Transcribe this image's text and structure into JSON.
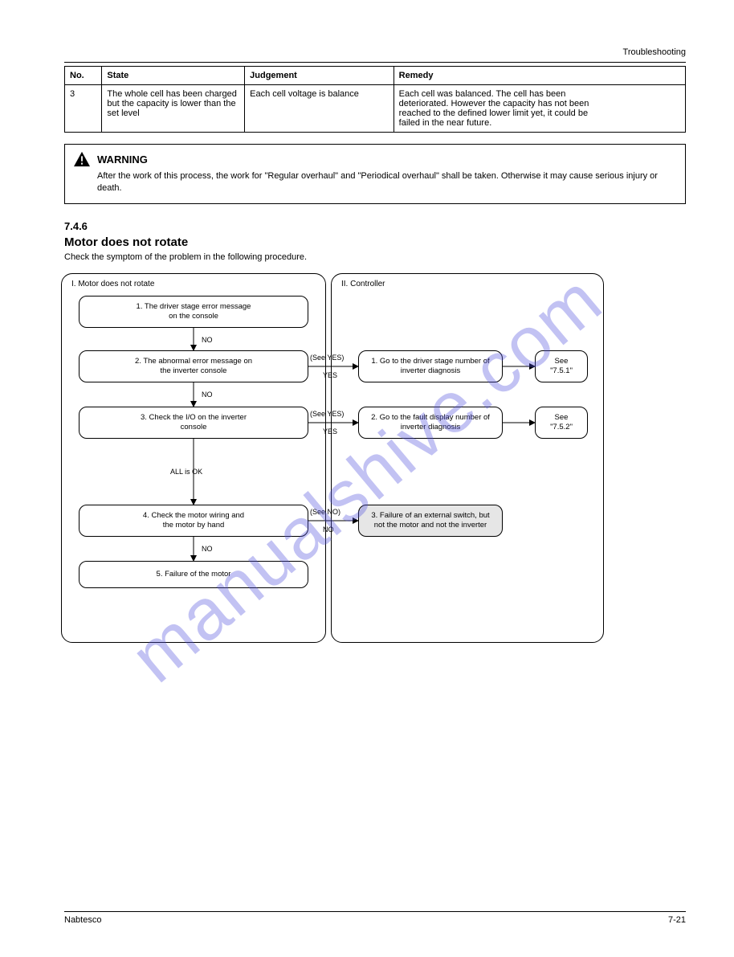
{
  "header": {
    "title": "Troubleshooting"
  },
  "table": {
    "cols": [
      "No.",
      "State",
      "Judgement",
      "Remedy"
    ],
    "row": {
      "no": "3",
      "state_lines": [
        "The whole cell has been charged",
        "but the capacity is lower than the",
        "set level"
      ],
      "judgement_lines": [
        "Each cell voltage is balance"
      ],
      "remedy_lines": [
        "Each cell was balanced. The cell has been",
        "deteriorated. However the capacity has not been",
        "reached to the defined lower limit yet, it could be",
        "failed in the near future."
      ]
    }
  },
  "warning": {
    "label": "WARNING",
    "text": "After the work of this process, the work for \"Regular overhaul\" and \"Periodical overhaul\" shall be taken. Otherwise it may cause serious injury or death."
  },
  "section": {
    "num": "7.4.6",
    "title": "Motor does not rotate",
    "sub": "Check the symptom of the problem in the following procedure."
  },
  "flow": {
    "panel_i": "I. Motor does not rotate",
    "panel_ii": "II. Controller",
    "n1": [
      "1. The driver stage error message",
      "on the console"
    ],
    "n2": [
      "2. The abnormal error message on",
      "the inverter console"
    ],
    "n3": [
      "3. Check the I/O on the inverter",
      "console"
    ],
    "n4": [
      "4. Check the motor wiring and",
      "the motor by hand"
    ],
    "n5": [
      "5. Failure of the motor"
    ],
    "r1": [
      "1. Go to the driver stage number of",
      "inverter diagnosis"
    ],
    "r1r": [
      "See",
      "\"7.5.1\""
    ],
    "r2": [
      "2. Go to the fault display number of",
      "inverter diagnosis"
    ],
    "r2r": [
      "See",
      "\"7.5.2\""
    ],
    "r3": [
      "3. Failure of an external switch, but",
      "not the motor and not the inverter"
    ],
    "yes": "YES",
    "no": "NO",
    "see_yes": "(See YES)",
    "see_no": "(See NO)",
    "all_ok": "ALL is OK"
  },
  "footer": {
    "left": "Nabtesco",
    "right": "7-21"
  },
  "watermark": "manualshive.com"
}
